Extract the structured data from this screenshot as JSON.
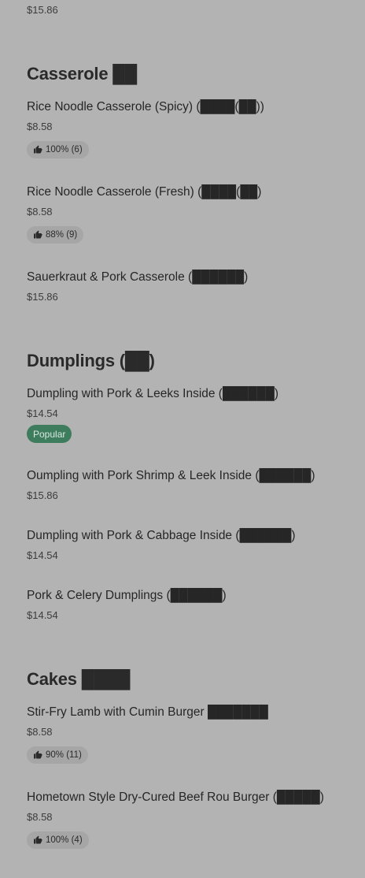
{
  "top": {
    "price": "$15.86"
  },
  "sections": [
    {
      "title": "Casserole ██",
      "items": [
        {
          "name": "Rice Noodle Casserole (Spicy) (████(██))",
          "price": "$8.58",
          "rating": "100% (6)"
        },
        {
          "name": "Rice Noodle Casserole (Fresh) (████(██)",
          "price": "$8.58",
          "rating": "88% (9)"
        },
        {
          "name": "Sauerkraut & Pork Casserole (██████)",
          "price": "$15.86"
        }
      ]
    },
    {
      "title": "Dumplings (██)",
      "items": [
        {
          "name": "Dumpling with Pork & Leeks Inside (██████)",
          "price": "$14.54",
          "badge": "Popular"
        },
        {
          "name": "Oumpling with Pork Shrimp & Leek Inside (██████)",
          "price": "$15.86"
        },
        {
          "name": "Dumpling with Pork & Cabbage Inside (██████)",
          "price": "$14.54"
        },
        {
          "name": "Pork & Celery Dumplings (██████)",
          "price": "$14.54"
        }
      ]
    },
    {
      "title": "Cakes ████",
      "items": [
        {
          "name": "Stir-Fry Lamb with Cumin Burger ███████",
          "price": "$8.58",
          "rating": "90% (11)"
        },
        {
          "name": "Hometown Style Dry-Cured Beef Rou Burger (█████)",
          "price": "$8.58",
          "rating": "100% (4)"
        }
      ]
    }
  ],
  "icons": {
    "rating_icon": "thumbs-up-icon"
  },
  "colors": {
    "background": "#b3b3b3",
    "badge_popular": "#3e7c5e",
    "rating_pill": "#a6a6a6"
  }
}
